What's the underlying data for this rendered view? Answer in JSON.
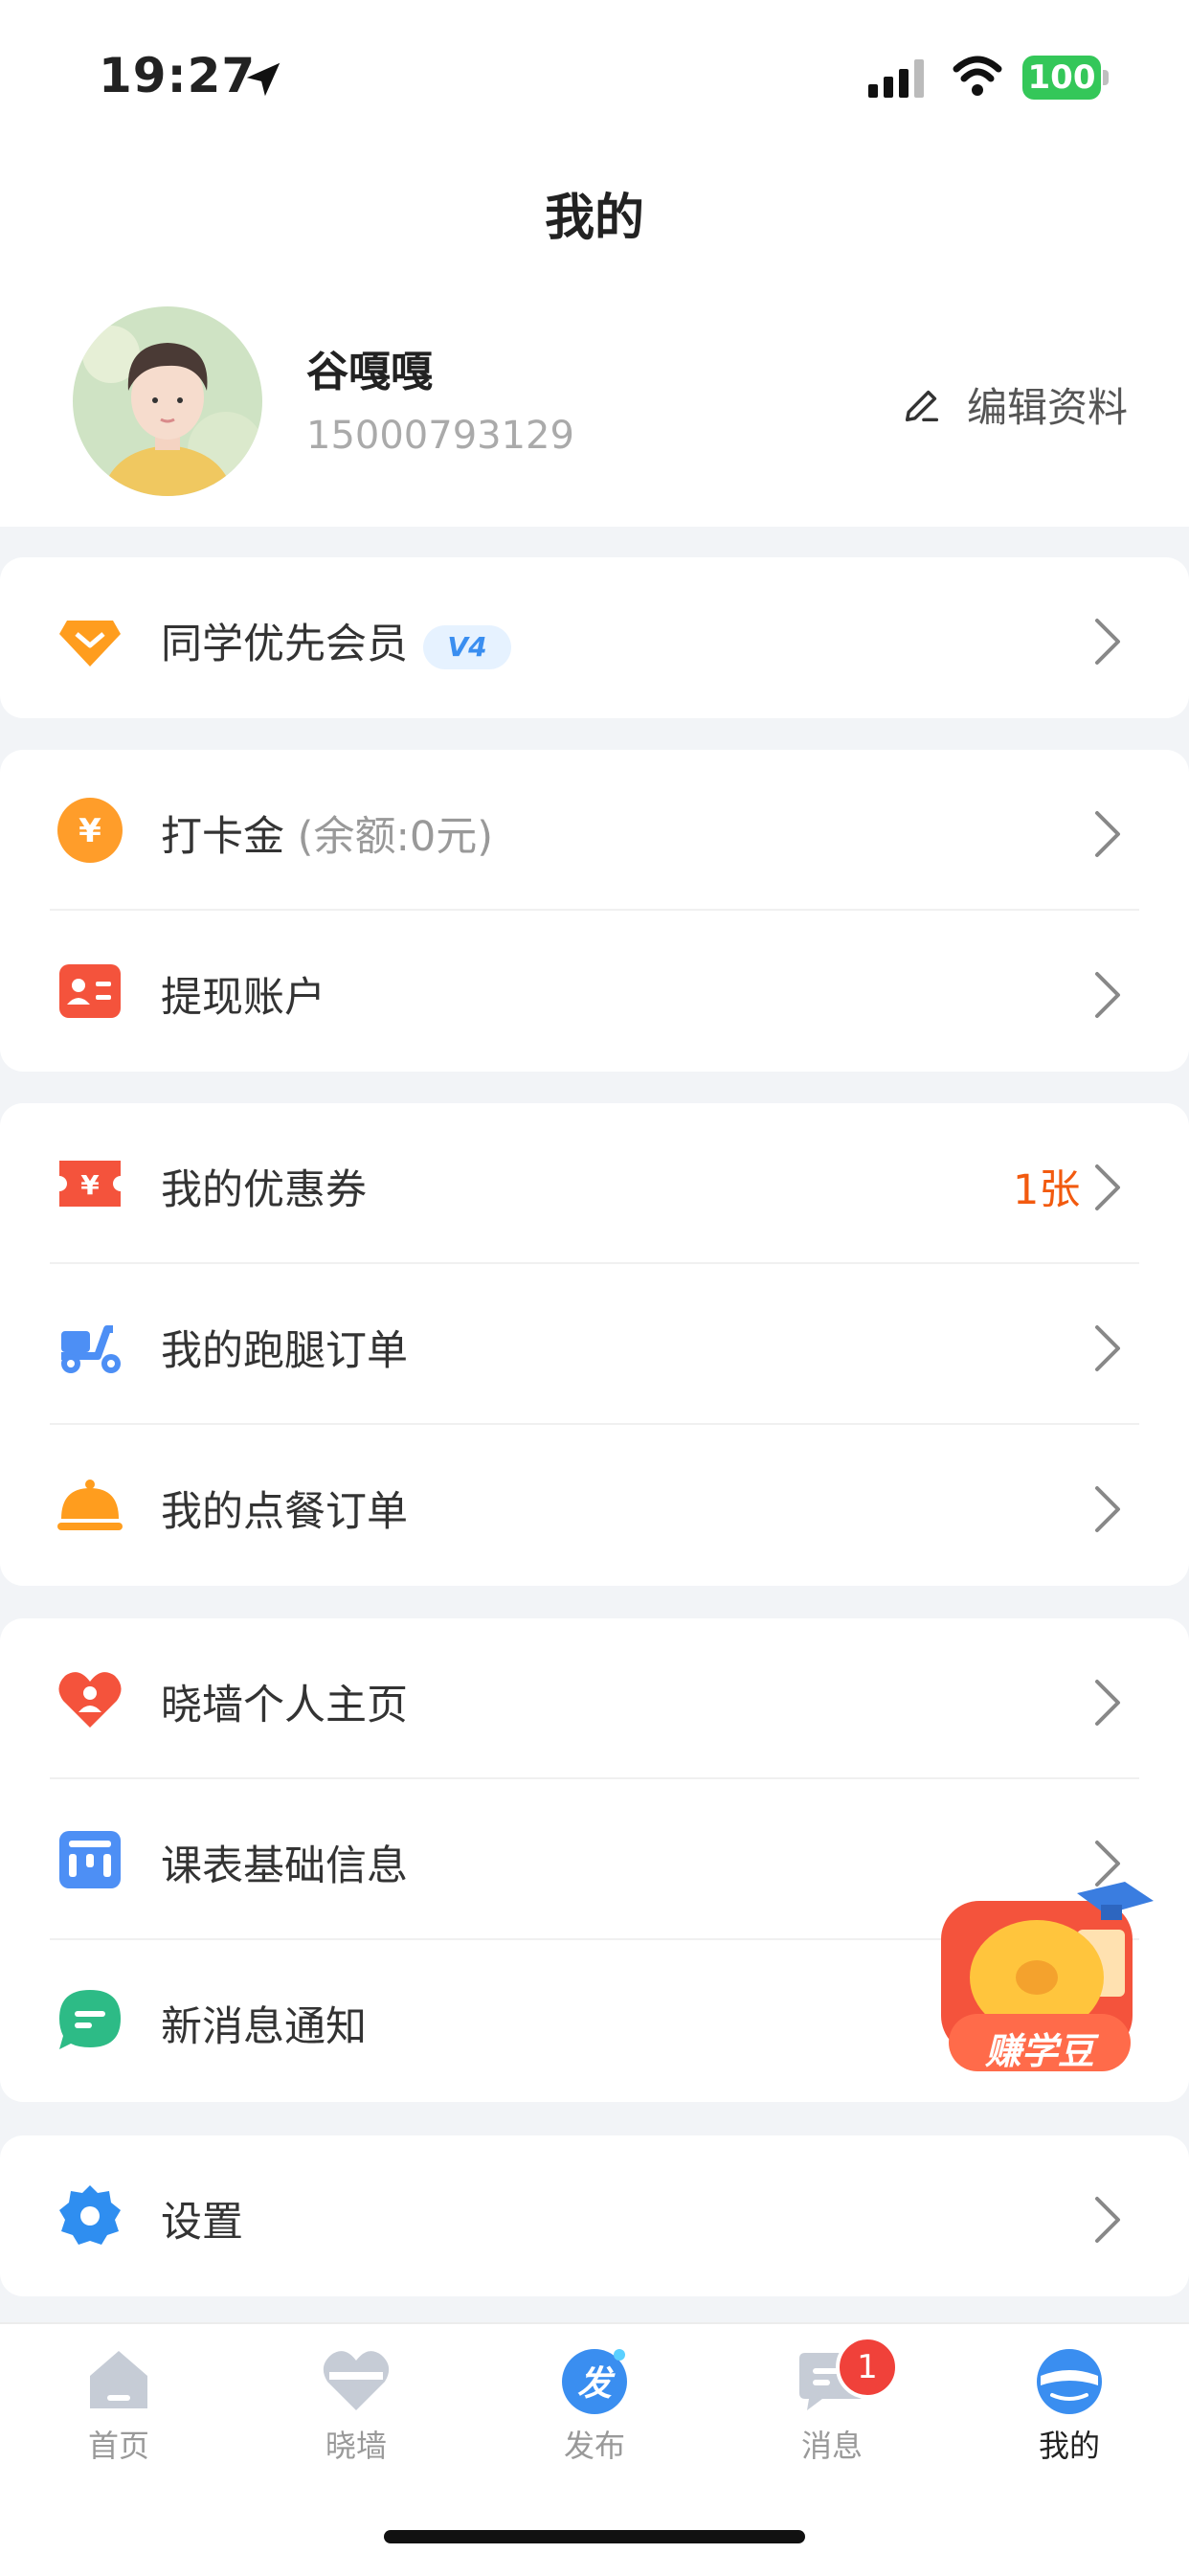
{
  "status_bar": {
    "time": "19:27",
    "battery": "100"
  },
  "header": {
    "title": "我的"
  },
  "profile": {
    "name": "谷嘎嘎",
    "phone": "15000793129",
    "edit_label": "编辑资料"
  },
  "membership": {
    "label": "同学优先会员",
    "level": "V4"
  },
  "wallet": {
    "checkin_label": "打卡金",
    "checkin_balance": "(余额:0元)",
    "withdraw_label": "提现账户"
  },
  "orders": {
    "coupon_label": "我的优惠券",
    "coupon_count": "1张",
    "errand_label": "我的跑腿订单",
    "food_label": "我的点餐订单"
  },
  "more": {
    "wall_label": "晓墙个人主页",
    "timetable_label": "课表基础信息",
    "notify_label": "新消息通知"
  },
  "settings": {
    "label": "设置"
  },
  "fab": {
    "label": "赚学豆"
  },
  "tabbar": {
    "home": "首页",
    "wall": "晓墙",
    "publish": "发布",
    "publish_icon_text": "发",
    "messages": "消息",
    "messages_badge": "1",
    "mine": "我的"
  },
  "colors": {
    "accent": "#f25a0f",
    "active_tab": "#3a8ef0",
    "badge": "#f0413a"
  }
}
